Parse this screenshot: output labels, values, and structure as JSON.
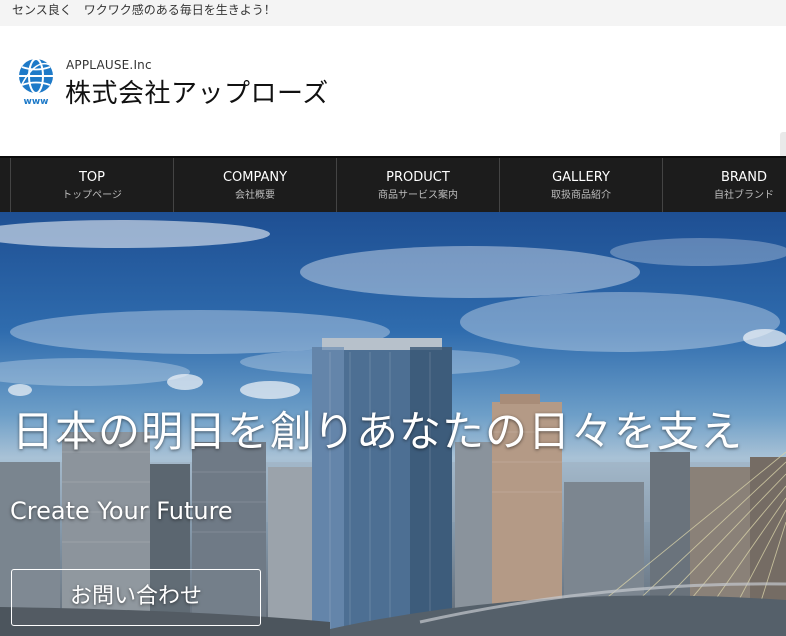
{
  "topbar": {
    "tagline": "センス良く　ワクワク感のある毎日を生きよう！"
  },
  "header": {
    "logo_icon": "globe-www-icon",
    "logo_caption": "www",
    "company_en": "APPLAUSE.Inc",
    "company_ja": "株式会社アップローズ"
  },
  "nav": {
    "items": [
      {
        "label": "TOP",
        "sub": "トップページ"
      },
      {
        "label": "COMPANY",
        "sub": "会社概要"
      },
      {
        "label": "PRODUCT",
        "sub": "商品サービス案内"
      },
      {
        "label": "GALLERY",
        "sub": "取扱商品紹介"
      },
      {
        "label": "BRAND",
        "sub": "自社ブランド"
      }
    ]
  },
  "hero": {
    "title": "日本の明日を創りあなたの日々を支え",
    "subtitle": "Create Your Future",
    "button_label": "お問い合わせ"
  },
  "colors": {
    "nav_bg": "#1c1c1c",
    "topbar_bg": "#f4f4f4",
    "logo_blue": "#1e7ac8"
  }
}
